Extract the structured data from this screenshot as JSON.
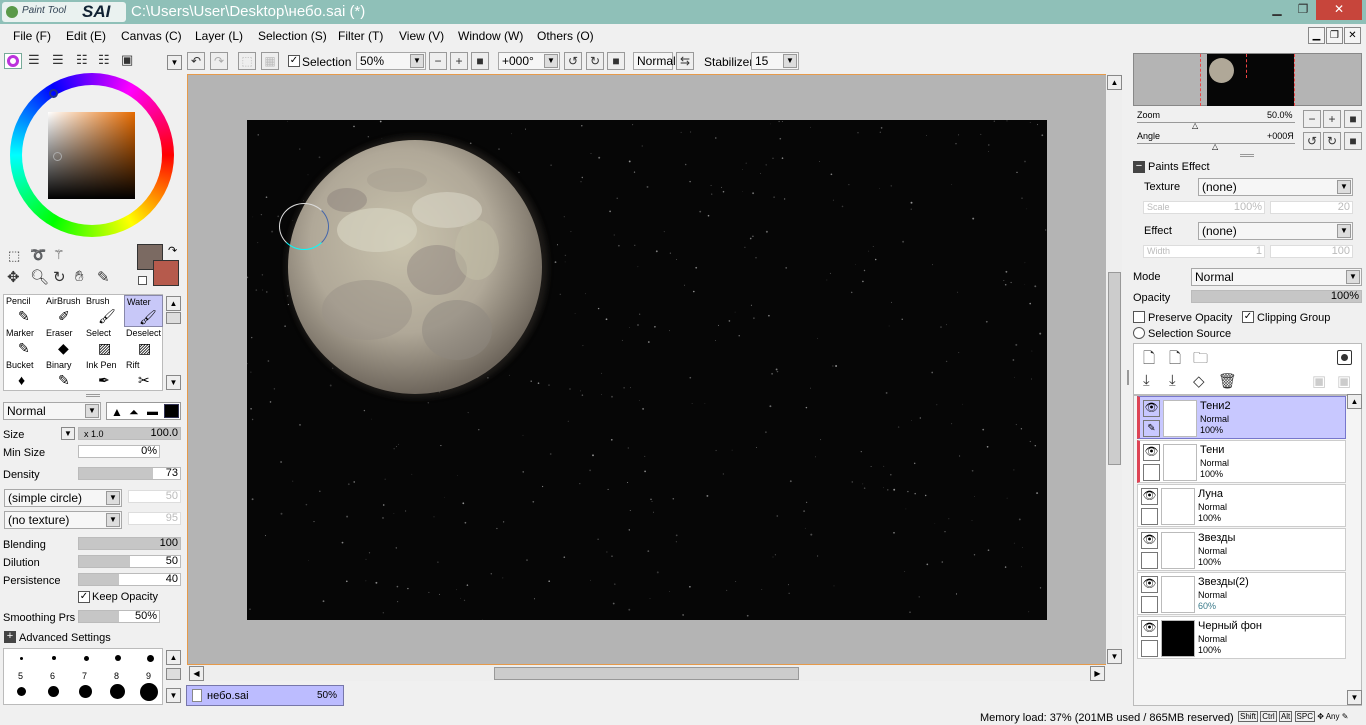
{
  "app": {
    "logo_small": "Paint Tool",
    "logo_big": "SAI",
    "title": "C:\\Users\\User\\Desktop\\небо.sai (*)"
  },
  "menu": [
    "File (F)",
    "Edit (E)",
    "Canvas (C)",
    "Layer (L)",
    "Selection (S)",
    "Filter (T)",
    "View (V)",
    "Window (W)",
    "Others (O)"
  ],
  "toolbar": {
    "selection_label": "Selection",
    "zoom": "50%",
    "angle": "+000°",
    "blend_mode": "Normal",
    "stabilizer_label": "Stabilizer",
    "stabilizer_value": "15"
  },
  "colors": {
    "primary": "#7b6a62",
    "secondary": "#b65a4c",
    "accent": "#8fc0b8"
  },
  "tools": [
    {
      "label": "Pencil",
      "icon": "pencil-icon"
    },
    {
      "label": "AirBrush",
      "icon": "airbrush-icon"
    },
    {
      "label": "Brush",
      "icon": "brush-icon"
    },
    {
      "label": "Water",
      "icon": "water-brush-icon"
    },
    {
      "label": "Marker",
      "icon": "marker-icon"
    },
    {
      "label": "Eraser",
      "icon": "eraser-icon"
    },
    {
      "label": "Select",
      "icon": "select-icon"
    },
    {
      "label": "Deselect",
      "icon": "deselect-icon"
    },
    {
      "label": "Bucket",
      "icon": "bucket-icon"
    },
    {
      "label": "Binary",
      "icon": "binary-pen-icon"
    },
    {
      "label": "Ink Pen",
      "icon": "ink-pen-icon"
    },
    {
      "label": "Rift",
      "icon": "rift-icon"
    }
  ],
  "brush": {
    "mode": "Normal",
    "size_label": "Size",
    "size_mult": "x 1.0",
    "size_value": "100.0",
    "min_size_label": "Min Size",
    "min_size_value": "0%",
    "density_label": "Density",
    "density_value": "73",
    "density_level": 73,
    "shape": "(simple circle)",
    "shape_value": "50",
    "texture": "(no texture)",
    "texture_value": "95",
    "blending_label": "Blending",
    "blending_value": "100",
    "blending_level": 100,
    "dilution_label": "Dilution",
    "dilution_value": "50",
    "dilution_level": 50,
    "persistence_label": "Persistence",
    "persistence_value": "40",
    "persistence_level": 40,
    "keep_opacity": "Keep Opacity",
    "smoothing_label": "Smoothing Prs",
    "smoothing_value": "50%",
    "advanced": "Advanced Settings",
    "size_presets_row1": [
      "5",
      "6",
      "7",
      "8",
      "9"
    ]
  },
  "document_tab": {
    "name": "небо.sai",
    "zoom": "50%"
  },
  "navigator": {
    "zoom_label": "Zoom",
    "zoom_value": "50.0%",
    "angle_label": "Angle",
    "angle_value": "+000Я"
  },
  "paint_effect": {
    "title": "Paints Effect",
    "texture_label": "Texture",
    "texture_value": "(none)",
    "scale_label": "Scale",
    "scale_value": "100%",
    "scale_amount": "20",
    "effect_label": "Effect",
    "effect_value": "(none)",
    "width_label": "Width",
    "width_value": "1",
    "width_amount": "100"
  },
  "layer_props": {
    "mode_label": "Mode",
    "mode_value": "Normal",
    "opacity_label": "Opacity",
    "opacity_value": "100%",
    "preserve_opacity": "Preserve Opacity",
    "clipping_group": "Clipping Group",
    "selection_source": "Selection Source"
  },
  "layers": [
    {
      "name": "Тени2",
      "mode": "Normal",
      "opacity": "100%",
      "selected": true,
      "clipped": true
    },
    {
      "name": "Тени",
      "mode": "Normal",
      "opacity": "100%",
      "selected": false,
      "clipped": true
    },
    {
      "name": "Луна",
      "mode": "Normal",
      "opacity": "100%",
      "selected": false,
      "clipped": false
    },
    {
      "name": "Звезды",
      "mode": "Normal",
      "opacity": "100%",
      "selected": false,
      "clipped": false
    },
    {
      "name": "Звезды(2)",
      "mode": "Normal",
      "opacity": "60%",
      "selected": false,
      "clipped": false
    },
    {
      "name": "Черный фон",
      "mode": "Normal",
      "opacity": "100%",
      "selected": false,
      "clipped": false
    }
  ],
  "status": {
    "memory": "Memory load: 37% (201MB used / 865MB reserved)",
    "keys": [
      "Shift",
      "Ctrl",
      "Alt",
      "SPC"
    ],
    "any": "Any"
  }
}
